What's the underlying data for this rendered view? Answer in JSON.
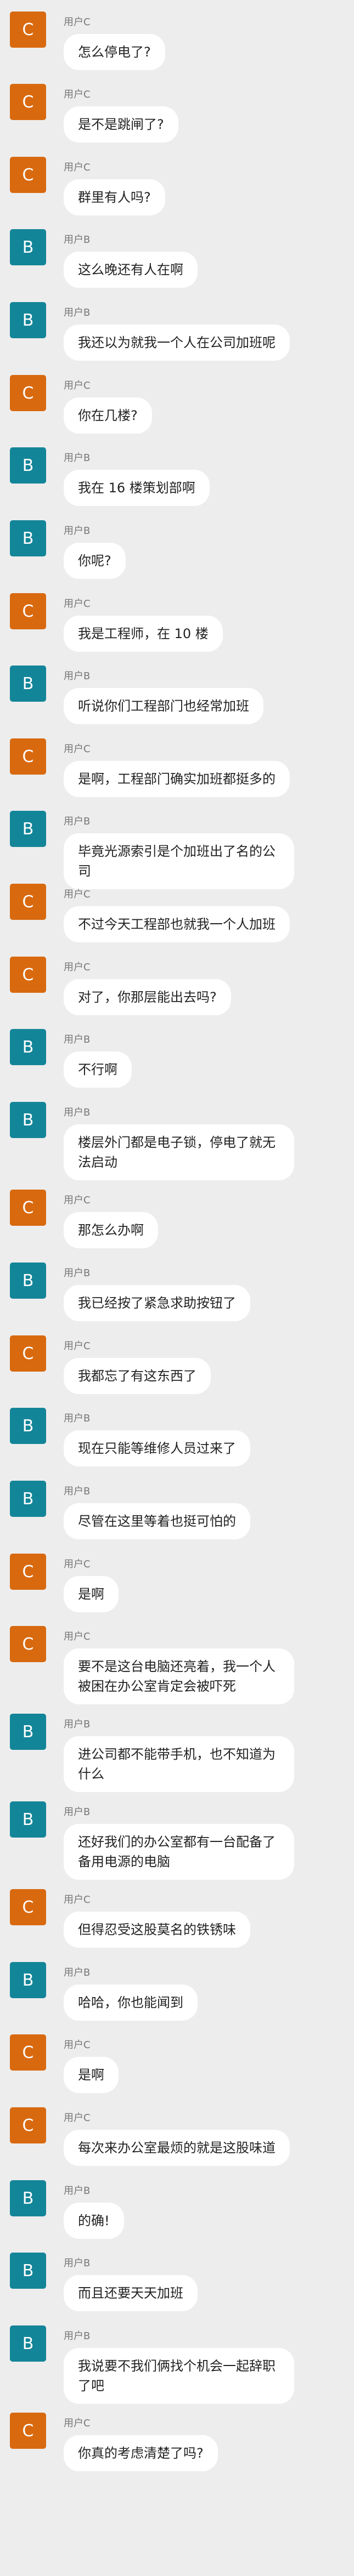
{
  "users": {
    "C": {
      "name": "用户C",
      "avatar": "C",
      "color": "#d8690f"
    },
    "B": {
      "name": "用户B",
      "avatar": "B",
      "color": "#138598"
    }
  },
  "messages": [
    {
      "user": "C",
      "name": "用户C",
      "avatar": "C",
      "text": "怎么停电了?"
    },
    {
      "user": "C",
      "name": "用户C",
      "avatar": "C",
      "text": "是不是跳闸了?"
    },
    {
      "user": "C",
      "name": "用户C",
      "avatar": "C",
      "text": "群里有人吗?"
    },
    {
      "user": "B",
      "name": "用户B",
      "avatar": "B",
      "text": "这么晚还有人在啊"
    },
    {
      "user": "B",
      "name": "用户B",
      "avatar": "B",
      "text": "我还以为就我一个人在公司加班呢"
    },
    {
      "user": "C",
      "name": "用户C",
      "avatar": "C",
      "text": "你在几楼?"
    },
    {
      "user": "B",
      "name": "用户B",
      "avatar": "B",
      "text": "我在 16 楼策划部啊"
    },
    {
      "user": "B",
      "name": "用户B",
      "avatar": "B",
      "text": "你呢?"
    },
    {
      "user": "C",
      "name": "用户C",
      "avatar": "C",
      "text": "我是工程师，在 10 楼"
    },
    {
      "user": "B",
      "name": "用户B",
      "avatar": "B",
      "text": "听说你们工程部门也经常加班"
    },
    {
      "user": "C",
      "name": "用户C",
      "avatar": "C",
      "text": "是啊，工程部门确实加班都挺多的"
    },
    {
      "user": "B",
      "name": "用户B",
      "avatar": "B",
      "text": "毕竟光源索引是个加班出了名的公司"
    },
    {
      "user": "C",
      "name": "用户C",
      "avatar": "C",
      "text": "不过今天工程部也就我一个人加班"
    },
    {
      "user": "C",
      "name": "用户C",
      "avatar": "C",
      "text": "对了，你那层能出去吗?"
    },
    {
      "user": "B",
      "name": "用户B",
      "avatar": "B",
      "text": "不行啊"
    },
    {
      "user": "B",
      "name": "用户B",
      "avatar": "B",
      "text": "楼层外门都是电子锁，停电了就无法启动"
    },
    {
      "user": "C",
      "name": "用户C",
      "avatar": "C",
      "text": "那怎么办啊"
    },
    {
      "user": "B",
      "name": "用户B",
      "avatar": "B",
      "text": "我已经按了紧急求助按钮了"
    },
    {
      "user": "C",
      "name": "用户C",
      "avatar": "C",
      "text": "我都忘了有这东西了"
    },
    {
      "user": "B",
      "name": "用户B",
      "avatar": "B",
      "text": "现在只能等维修人员过来了"
    },
    {
      "user": "B",
      "name": "用户B",
      "avatar": "B",
      "text": "尽管在这里等着也挺可怕的"
    },
    {
      "user": "C",
      "name": "用户C",
      "avatar": "C",
      "text": "是啊"
    },
    {
      "user": "C",
      "name": "用户C",
      "avatar": "C",
      "text": "要不是这台电脑还亮着，我一个人被困在办公室肯定会被吓死"
    },
    {
      "user": "B",
      "name": "用户B",
      "avatar": "B",
      "text": "进公司都不能带手机，也不知道为什么"
    },
    {
      "user": "B",
      "name": "用户B",
      "avatar": "B",
      "text": "还好我们的办公室都有一台配备了备用电源的电脑"
    },
    {
      "user": "C",
      "name": "用户C",
      "avatar": "C",
      "text": "但得忍受这股莫名的铁锈味"
    },
    {
      "user": "B",
      "name": "用户B",
      "avatar": "B",
      "text": "哈哈，你也能闻到"
    },
    {
      "user": "C",
      "name": "用户C",
      "avatar": "C",
      "text": "是啊"
    },
    {
      "user": "C",
      "name": "用户C",
      "avatar": "C",
      "text": "每次来办公室最烦的就是这股味道"
    },
    {
      "user": "B",
      "name": "用户B",
      "avatar": "B",
      "text": "的确!"
    },
    {
      "user": "B",
      "name": "用户B",
      "avatar": "B",
      "text": "而且还要天天加班"
    },
    {
      "user": "B",
      "name": "用户B",
      "avatar": "B",
      "text": "我说要不我们俩找个机会一起辞职了吧"
    },
    {
      "user": "C",
      "name": "用户C",
      "avatar": "C",
      "text": "你真的考虑清楚了吗?"
    }
  ]
}
